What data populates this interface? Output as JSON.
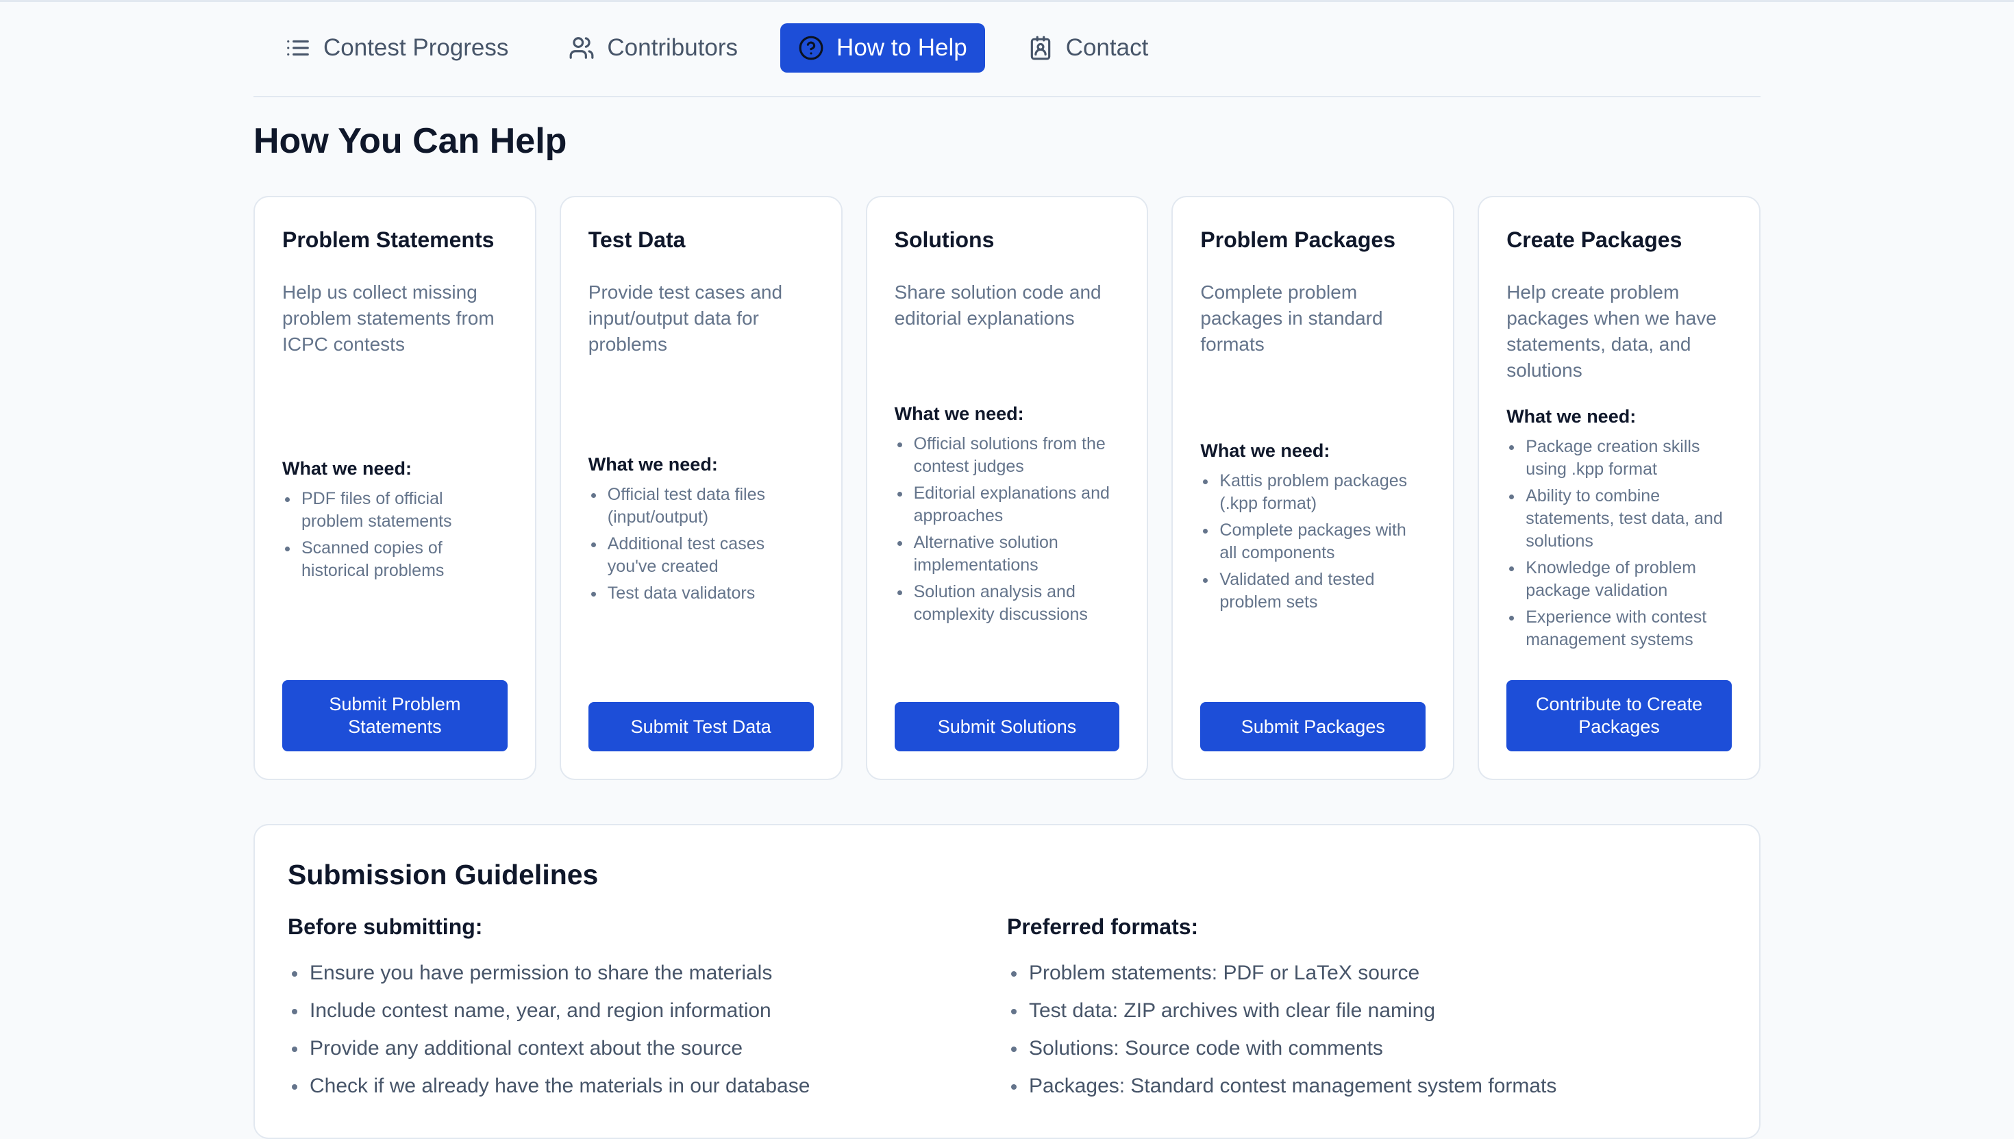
{
  "nav": {
    "tabs": [
      {
        "label": "Contest Progress",
        "icon": "list-icon",
        "active": false
      },
      {
        "label": "Contributors",
        "icon": "users-icon",
        "active": false
      },
      {
        "label": "How to Help",
        "icon": "help-circle-icon",
        "active": true
      },
      {
        "label": "Contact",
        "icon": "contact-card-icon",
        "active": false
      }
    ]
  },
  "page": {
    "title": "How You Can Help"
  },
  "need_label": "What we need:",
  "cards": [
    {
      "title": "Problem Statements",
      "description": "Help us collect missing problem statements from ICPC contests",
      "needs": [
        "PDF files of official problem statements",
        "Scanned copies of historical problems"
      ],
      "button": "Submit Problem Statements"
    },
    {
      "title": "Test Data",
      "description": "Provide test cases and input/output data for problems",
      "needs": [
        "Official test data files (input/output)",
        "Additional test cases you've created",
        "Test data validators"
      ],
      "button": "Submit Test Data"
    },
    {
      "title": "Solutions",
      "description": "Share solution code and editorial explanations",
      "needs": [
        "Official solutions from the contest judges",
        "Editorial explanations and approaches",
        "Alternative solution implementations",
        "Solution analysis and complexity discussions"
      ],
      "button": "Submit Solutions"
    },
    {
      "title": "Problem Packages",
      "description": "Complete problem packages in standard formats",
      "needs": [
        "Kattis problem packages (.kpp format)",
        "Complete packages with all components",
        "Validated and tested problem sets"
      ],
      "button": "Submit Packages"
    },
    {
      "title": "Create Packages",
      "description": "Help create problem packages when we have statements, data, and solutions",
      "needs": [
        "Package creation skills using .kpp format",
        "Ability to combine statements, test data, and solutions",
        "Knowledge of problem package validation",
        "Experience with contest management systems"
      ],
      "button": "Contribute to Create Packages"
    }
  ],
  "guidelines": {
    "title": "Submission Guidelines",
    "before": {
      "heading": "Before submitting:",
      "items": [
        "Ensure you have permission to share the materials",
        "Include contest name, year, and region information",
        "Provide any additional context about the source",
        "Check if we already have the materials in our database"
      ]
    },
    "formats": {
      "heading": "Preferred formats:",
      "items": [
        "Problem statements: PDF or LaTeX source",
        "Test data: ZIP archives with clear file naming",
        "Solutions: Source code with comments",
        "Packages: Standard contest management system formats"
      ]
    }
  },
  "colors": {
    "accent": "#1d4ed8",
    "muted_text": "#64748b",
    "border": "#e2e8f0"
  }
}
